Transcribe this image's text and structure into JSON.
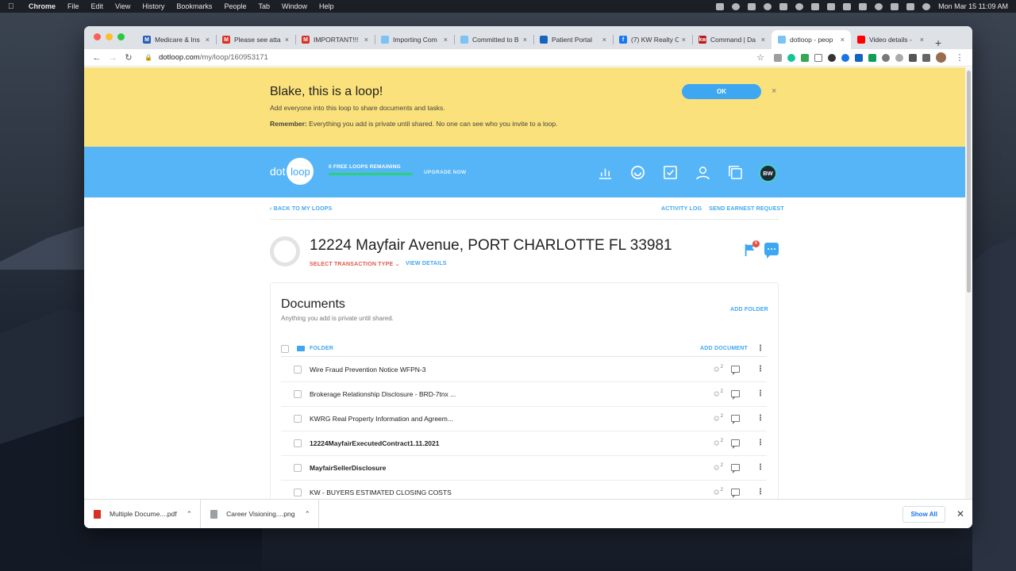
{
  "menubar": {
    "app": "Chrome",
    "items": [
      "File",
      "Edit",
      "View",
      "History",
      "Bookmarks",
      "People",
      "Tab",
      "Window",
      "Help"
    ],
    "clock": "Mon Mar 15  11:09 AM"
  },
  "tabs": [
    {
      "title": "Medicare & Ins",
      "favicon_color": "#2b5fb5",
      "favicon_letter": "M"
    },
    {
      "title": "Please see atta",
      "favicon_color": "#d93025",
      "favicon_letter": "M"
    },
    {
      "title": "IMPORTANT!!!",
      "favicon_color": "#d93025",
      "favicon_letter": "M"
    },
    {
      "title": "Importing Com",
      "favicon_color": "#7cc2f5",
      "favicon_letter": ""
    },
    {
      "title": "Committed to B",
      "favicon_color": "#7cc2f5",
      "favicon_letter": ""
    },
    {
      "title": "Patient Portal",
      "favicon_color": "#1565c0",
      "favicon_letter": ""
    },
    {
      "title": "(7) KW Realty C",
      "favicon_color": "#1877f2",
      "favicon_letter": "f"
    },
    {
      "title": "Command | Da",
      "favicon_color": "#b71c1c",
      "favicon_letter": "kw"
    },
    {
      "title": "dotloop - peop",
      "favicon_color": "#7cc2f5",
      "favicon_letter": "",
      "active": true
    },
    {
      "title": "Video details -",
      "favicon_color": "#ff0000",
      "favicon_letter": ""
    }
  ],
  "omnibox": {
    "host": "dotloop.com",
    "path": "/my/loop/160953171"
  },
  "banner": {
    "title": "Blake, this is a loop!",
    "subtitle": "Add everyone into this loop to share documents and tasks.",
    "remember_label": "Remember:",
    "remember_text": "Everything you add is private until shared. No one can see who you invite to a loop.",
    "ok_label": "OK",
    "close": "×"
  },
  "brand": {
    "logo_dot": "dot",
    "logo_loop": "loop",
    "free_loops": "0 FREE LOOPS REMAINING",
    "upgrade": "UPGRADE NOW",
    "avatar_initials": "BW"
  },
  "loop": {
    "back": "BACK TO MY LOOPS",
    "activity_log": "ACTIVITY LOG",
    "send_earnest": "SEND EARNEST REQUEST",
    "address": "12224 Mayfair Avenue, PORT CHARLOTTE FL 33981",
    "select_type": "SELECT TRANSACTION TYPE",
    "view_details": "VIEW DETAILS",
    "flag_count": "6"
  },
  "documents": {
    "title": "Documents",
    "subtitle": "Anything you add is private until shared.",
    "add_folder": "ADD FOLDER",
    "folder_label": "FOLDER",
    "add_document": "ADD DOCUMENT",
    "rows": [
      {
        "name": "Wire Fraud Prevention Notice WFPN-3",
        "bold": false,
        "people": "2"
      },
      {
        "name": "Brokerage Relationship Disclosure - BRD-7tnx ...",
        "bold": false,
        "people": "2"
      },
      {
        "name": "KWRG Real Property Information and Agreem...",
        "bold": false,
        "people": "2"
      },
      {
        "name": "12224MayfairExecutedContract1.11.2021",
        "bold": true,
        "people": "2"
      },
      {
        "name": "MayfairSellerDisclosure",
        "bold": true,
        "people": "2"
      },
      {
        "name": "KW - BUYERS ESTIMATED CLOSING COSTS",
        "bold": false,
        "people": "2"
      }
    ]
  },
  "downloads": {
    "items": [
      {
        "name": "Multiple Docume....pdf",
        "icon_color": "#d93025"
      },
      {
        "name": "Career Visioning....png",
        "icon_color": "#9aa0a6"
      }
    ],
    "show_all": "Show All"
  },
  "colors": {
    "accent": "#3ea7f2",
    "banner": "#fbe17b",
    "brandbar": "#55b5f7",
    "danger": "#e05a4c"
  }
}
